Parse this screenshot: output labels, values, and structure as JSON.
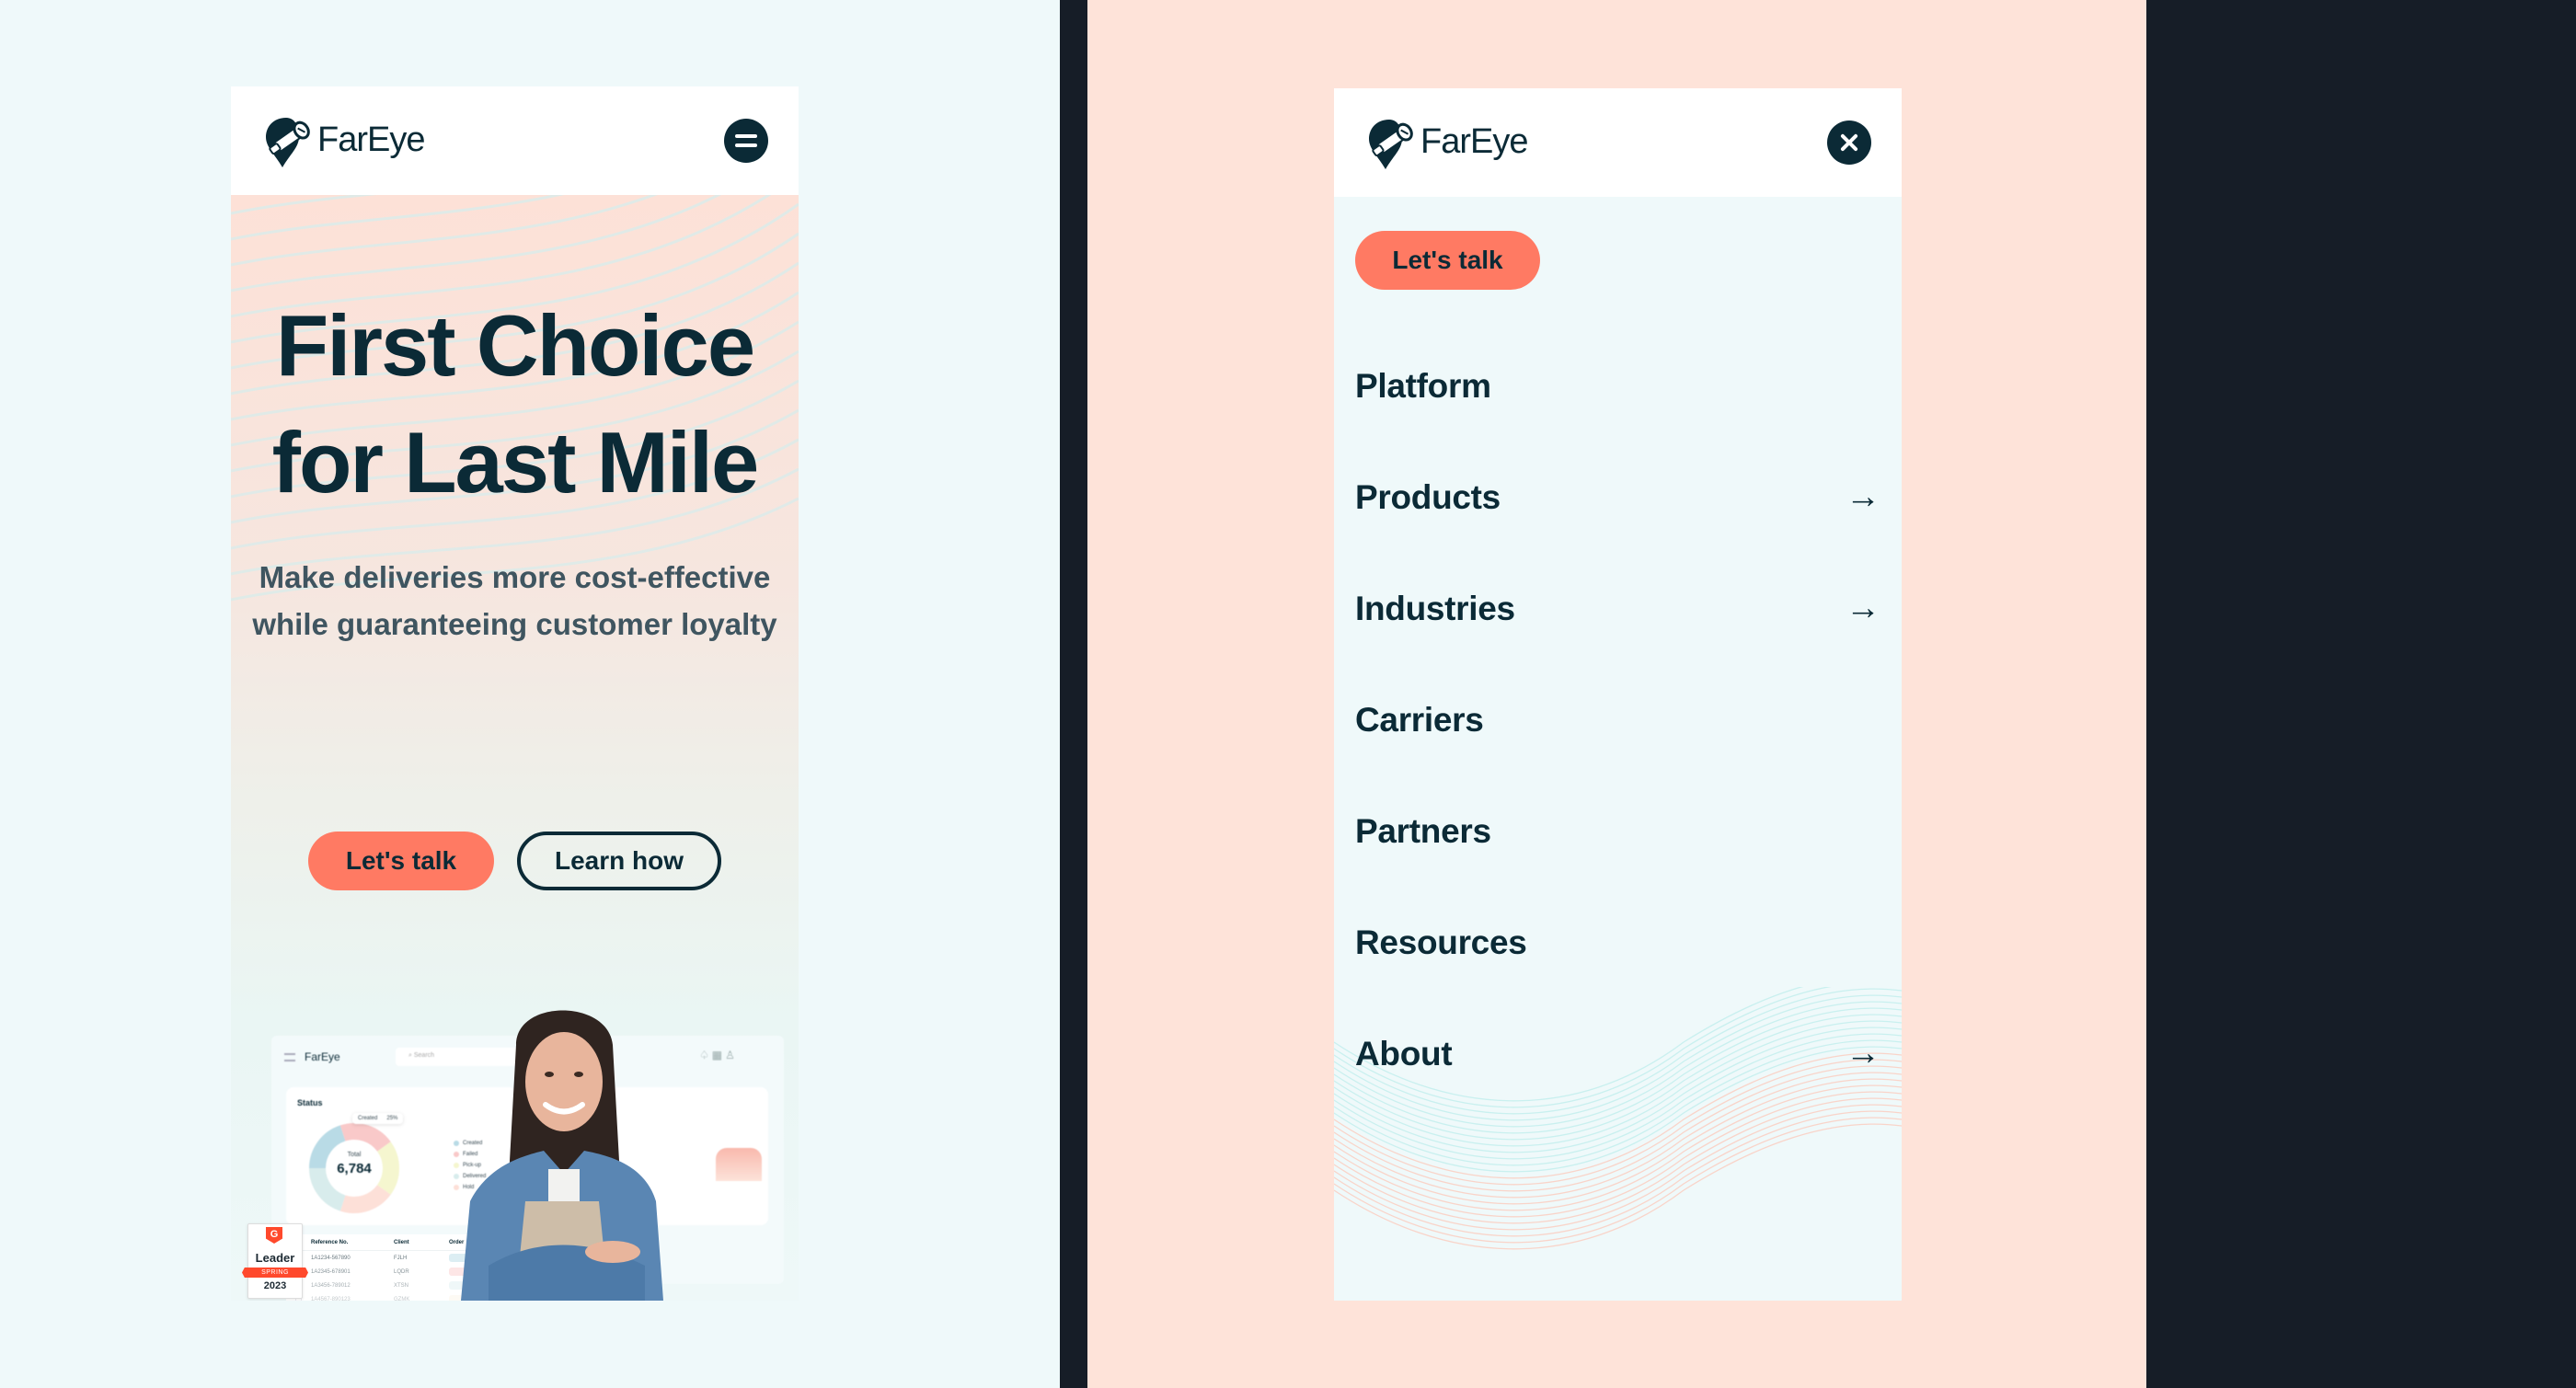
{
  "brand": {
    "name": "FarEye",
    "colors": {
      "primary_dark": "#0b2a36",
      "accent": "#ff7a63",
      "left_bg": "#eff9fa",
      "right_bg": "#fee3d9",
      "frame_dark": "#161d27"
    }
  },
  "home_view": {
    "header": {
      "logo_text": "FarEye",
      "menu_icon": "hamburger-icon"
    },
    "hero": {
      "title_line1": "First Choice",
      "title_line2": "for Last Mile",
      "subtitle": "Make deliveries more cost-effective while guaranteeing customer loyalty",
      "primary_button": "Let's talk",
      "secondary_button": "Learn how"
    },
    "dashboard_preview": {
      "logo_text": "FarEye",
      "search_placeholder": "Search",
      "status_card": {
        "title": "Status",
        "total_label": "Total",
        "total_value": "6,784",
        "tooltip_label": "Created",
        "tooltip_value": "25%",
        "legend": [
          {
            "label": "Created",
            "color": "#b9dbe6"
          },
          {
            "label": "Failed",
            "color": "#f9c9c9"
          },
          {
            "label": "Pick-up",
            "color": "#f5f6cf"
          },
          {
            "label": "Delivered",
            "color": "#d8ecec"
          },
          {
            "label": "Hold",
            "color": "#fde0d8"
          }
        ]
      },
      "orders_card": {
        "title": "Ord"
      },
      "table": {
        "headers": [
          "Reference No.",
          "Client",
          "Order"
        ],
        "rows": [
          {
            "ref": "1A1234-567890",
            "client": "FJLH",
            "status_color": "#dceef3"
          },
          {
            "ref": "1A2345-678901",
            "client": "LQDR",
            "status_color": "#fde0e0"
          },
          {
            "ref": "1A3456-789012",
            "client": "XTSN",
            "status_color": "#e6f2f4"
          },
          {
            "ref": "1A4567-890123",
            "client": "GZMK",
            "status_color": "#fbf3e4"
          }
        ]
      }
    },
    "badge": {
      "logo": "G",
      "title": "Leader",
      "season": "SPRING",
      "year": "2023"
    }
  },
  "menu_view": {
    "header": {
      "logo_text": "FarEye",
      "close_icon": "close-icon"
    },
    "cta_button": "Let's talk",
    "items": [
      {
        "label": "Platform",
        "has_submenu": false
      },
      {
        "label": "Products",
        "has_submenu": true
      },
      {
        "label": "Industries",
        "has_submenu": true
      },
      {
        "label": "Carriers",
        "has_submenu": false
      },
      {
        "label": "Partners",
        "has_submenu": false
      },
      {
        "label": "Resources",
        "has_submenu": false
      },
      {
        "label": "About",
        "has_submenu": true
      }
    ],
    "arrow_glyph": "→"
  }
}
